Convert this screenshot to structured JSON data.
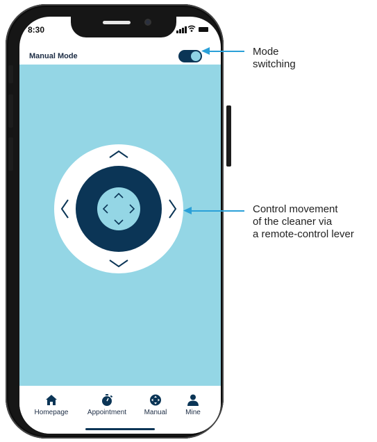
{
  "status_bar": {
    "time": "8:30",
    "icons": [
      "signal-icon",
      "wifi-icon",
      "battery-icon"
    ]
  },
  "header": {
    "title": "Manual Mode",
    "mode_toggle_on": true
  },
  "joystick": {
    "arrows": [
      "up",
      "down",
      "left",
      "right"
    ],
    "center_arrows": [
      "up",
      "down",
      "left",
      "right"
    ]
  },
  "bottom_nav": {
    "items": [
      {
        "label": "Homepage",
        "icon": "home-icon"
      },
      {
        "label": "Appointment",
        "icon": "stopwatch-icon"
      },
      {
        "label": "Manual",
        "icon": "joystick-icon"
      },
      {
        "label": "Mine",
        "icon": "user-icon"
      }
    ]
  },
  "annotations": {
    "mode": "Mode\nswitching",
    "control": "Control movement\nof the cleaner via\na remote-control lever"
  },
  "colors": {
    "accent": "#94d6e5",
    "dark_navy": "#0b3556",
    "callout": "#2aa0d8",
    "phone_frame": "#161616"
  }
}
